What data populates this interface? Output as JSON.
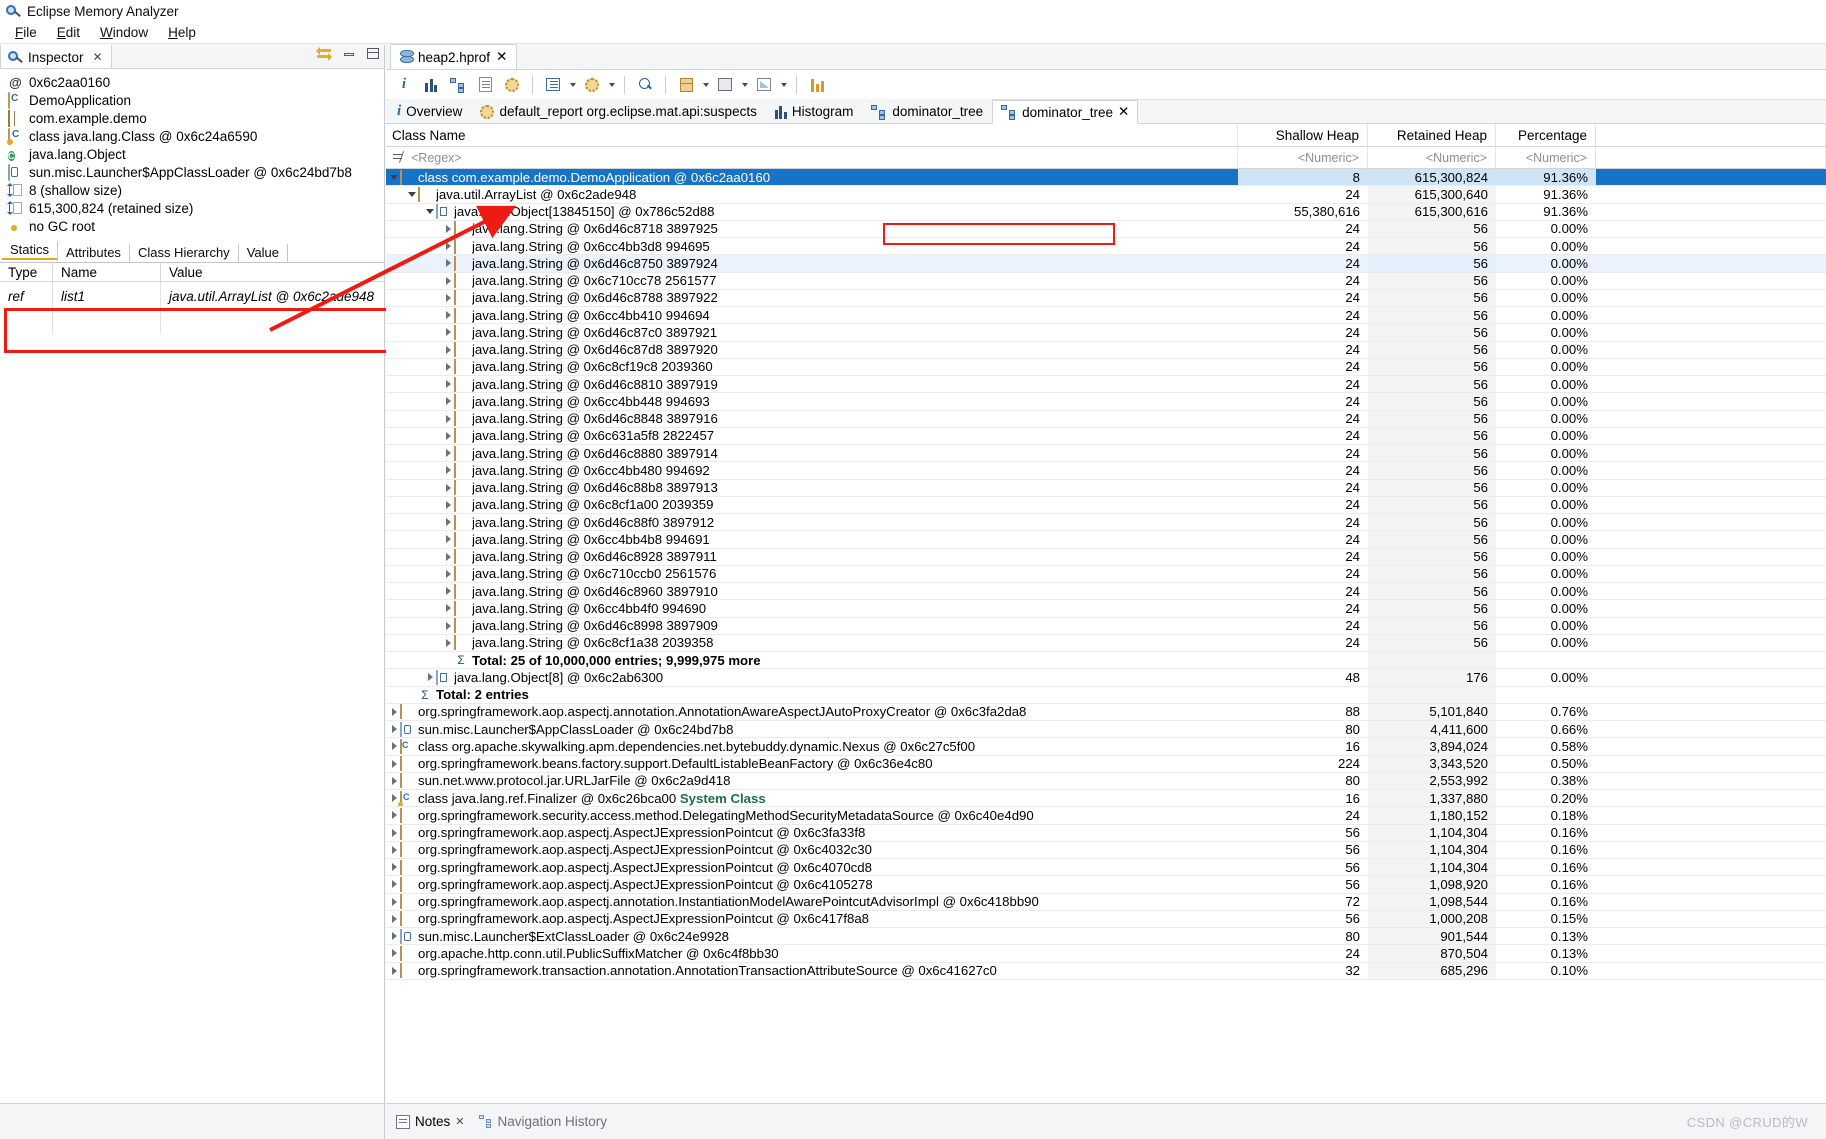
{
  "window": {
    "title": "Eclipse Memory Analyzer",
    "icon": "mat-logo-icon"
  },
  "menu": {
    "items": [
      "File",
      "Edit",
      "Window",
      "Help"
    ]
  },
  "inspector": {
    "tab_label": "Inspector",
    "tab_close": "✕",
    "rows": [
      {
        "icon": "at-icon",
        "text": "0x6c2aa0160"
      },
      {
        "icon": "class-icon",
        "text": "DemoApplication"
      },
      {
        "icon": "package-icon",
        "text": "com.example.demo"
      },
      {
        "icon": "class-object-icon",
        "text": "class java.lang.Class @ 0x6c24a6590"
      },
      {
        "icon": "superclass-icon",
        "text": "java.lang.Object"
      },
      {
        "icon": "classloader-icon",
        "text": "sun.misc.Launcher$AppClassLoader @ 0x6c24bd7b8"
      },
      {
        "icon": "size-icon",
        "text": "8 (shallow size)"
      },
      {
        "icon": "size-icon",
        "text": "615,300,824 (retained size)"
      },
      {
        "icon": "gc-root-icon",
        "text": "no GC root"
      }
    ],
    "subtabs": [
      {
        "label": "Statics",
        "active": true
      },
      {
        "label": "Attributes",
        "active": false
      },
      {
        "label": "Class Hierarchy",
        "active": false
      },
      {
        "label": "Value",
        "active": false
      }
    ],
    "statics_headers": [
      "Type",
      "Name",
      "Value"
    ],
    "statics_rows": [
      {
        "type": "ref",
        "name": "list1",
        "value": "java.util.ArrayList @ 0x6c2ade948"
      }
    ]
  },
  "editor": {
    "tab_label": "heap2.hprof",
    "tab_close": "✕",
    "toolbar_icons": [
      "overview-info-icon",
      "histogram-icon",
      "dominator-tree-icon",
      "report-icon",
      "gear-icon",
      "query-browser-icon",
      "caret-down-icon",
      "oql-icon",
      "caret-down-icon",
      "search-icon",
      "group-icon",
      "caret-down-icon",
      "calculator-icon",
      "caret-down-icon",
      "export-icon",
      "caret-down-icon",
      "compare-icon"
    ],
    "result_tabs": [
      {
        "label": "Overview",
        "icon": "info-icon",
        "active": false
      },
      {
        "label": "default_report org.eclipse.mat.api:suspects",
        "icon": "report-icon",
        "active": false
      },
      {
        "label": "Histogram",
        "icon": "histogram-icon",
        "active": false
      },
      {
        "label": "dominator_tree",
        "icon": "dominator-tree-icon",
        "active": false
      },
      {
        "label": "dominator_tree",
        "icon": "dominator-tree-icon",
        "active": true,
        "close": "✕"
      }
    ]
  },
  "table": {
    "headers": {
      "name": "Class Name",
      "shallow": "Shallow Heap",
      "retained": "Retained Heap",
      "percentage": "Percentage"
    },
    "filters": {
      "name": "<Regex>",
      "shallow": "<Numeric>",
      "retained": "<Numeric>",
      "percentage": "<Numeric>"
    },
    "rows": [
      {
        "indent": 0,
        "arrow": "down",
        "icon": "class-icon",
        "name": "class com.example.demo.DemoApplication @ 0x6c2aa0160",
        "shallow": "8",
        "retained": "615,300,824",
        "pct": "91.36%",
        "state": "selected"
      },
      {
        "indent": 1,
        "arrow": "down",
        "icon": "object-icon",
        "name": "java.util.ArrayList @ 0x6c2ade948",
        "shallow": "24",
        "retained": "615,300,640",
        "pct": "91.36%",
        "state": "normal"
      },
      {
        "indent": 2,
        "arrow": "down",
        "icon": "array-icon",
        "name": "java.lang.Object[13845150] @ 0x786c52d88",
        "shallow": "55,380,616",
        "retained": "615,300,616",
        "pct": "91.36%",
        "state": "normal"
      },
      {
        "indent": 3,
        "arrow": "right",
        "icon": "object-icon",
        "name": "java.lang.String @ 0x6d46c8718  3897925",
        "shallow": "24",
        "retained": "56",
        "pct": "0.00%",
        "state": "normal"
      },
      {
        "indent": 3,
        "arrow": "right",
        "icon": "object-icon",
        "name": "java.lang.String @ 0x6cc4bb3d8  994695",
        "shallow": "24",
        "retained": "56",
        "pct": "0.00%",
        "state": "normal"
      },
      {
        "indent": 3,
        "arrow": "right",
        "icon": "object-icon",
        "name": "java.lang.String @ 0x6d46c8750  3897924",
        "shallow": "24",
        "retained": "56",
        "pct": "0.00%",
        "state": "alt"
      },
      {
        "indent": 3,
        "arrow": "right",
        "icon": "object-icon",
        "name": "java.lang.String @ 0x6c710cc78  2561577",
        "shallow": "24",
        "retained": "56",
        "pct": "0.00%",
        "state": "normal"
      },
      {
        "indent": 3,
        "arrow": "right",
        "icon": "object-icon",
        "name": "java.lang.String @ 0x6d46c8788  3897922",
        "shallow": "24",
        "retained": "56",
        "pct": "0.00%",
        "state": "normal"
      },
      {
        "indent": 3,
        "arrow": "right",
        "icon": "object-icon",
        "name": "java.lang.String @ 0x6cc4bb410  994694",
        "shallow": "24",
        "retained": "56",
        "pct": "0.00%",
        "state": "normal"
      },
      {
        "indent": 3,
        "arrow": "right",
        "icon": "object-icon",
        "name": "java.lang.String @ 0x6d46c87c0  3897921",
        "shallow": "24",
        "retained": "56",
        "pct": "0.00%",
        "state": "normal"
      },
      {
        "indent": 3,
        "arrow": "right",
        "icon": "object-icon",
        "name": "java.lang.String @ 0x6d46c87d8  3897920",
        "shallow": "24",
        "retained": "56",
        "pct": "0.00%",
        "state": "normal"
      },
      {
        "indent": 3,
        "arrow": "right",
        "icon": "object-icon",
        "name": "java.lang.String @ 0x6c8cf19c8  2039360",
        "shallow": "24",
        "retained": "56",
        "pct": "0.00%",
        "state": "normal"
      },
      {
        "indent": 3,
        "arrow": "right",
        "icon": "object-icon",
        "name": "java.lang.String @ 0x6d46c8810  3897919",
        "shallow": "24",
        "retained": "56",
        "pct": "0.00%",
        "state": "normal"
      },
      {
        "indent": 3,
        "arrow": "right",
        "icon": "object-icon",
        "name": "java.lang.String @ 0x6cc4bb448  994693",
        "shallow": "24",
        "retained": "56",
        "pct": "0.00%",
        "state": "normal"
      },
      {
        "indent": 3,
        "arrow": "right",
        "icon": "object-icon",
        "name": "java.lang.String @ 0x6d46c8848  3897916",
        "shallow": "24",
        "retained": "56",
        "pct": "0.00%",
        "state": "normal"
      },
      {
        "indent": 3,
        "arrow": "right",
        "icon": "object-icon",
        "name": "java.lang.String @ 0x6c631a5f8  2822457",
        "shallow": "24",
        "retained": "56",
        "pct": "0.00%",
        "state": "normal"
      },
      {
        "indent": 3,
        "arrow": "right",
        "icon": "object-icon",
        "name": "java.lang.String @ 0x6d46c8880  3897914",
        "shallow": "24",
        "retained": "56",
        "pct": "0.00%",
        "state": "normal"
      },
      {
        "indent": 3,
        "arrow": "right",
        "icon": "object-icon",
        "name": "java.lang.String @ 0x6cc4bb480  994692",
        "shallow": "24",
        "retained": "56",
        "pct": "0.00%",
        "state": "normal"
      },
      {
        "indent": 3,
        "arrow": "right",
        "icon": "object-icon",
        "name": "java.lang.String @ 0x6d46c88b8  3897913",
        "shallow": "24",
        "retained": "56",
        "pct": "0.00%",
        "state": "normal"
      },
      {
        "indent": 3,
        "arrow": "right",
        "icon": "object-icon",
        "name": "java.lang.String @ 0x6c8cf1a00  2039359",
        "shallow": "24",
        "retained": "56",
        "pct": "0.00%",
        "state": "normal"
      },
      {
        "indent": 3,
        "arrow": "right",
        "icon": "object-icon",
        "name": "java.lang.String @ 0x6d46c88f0  3897912",
        "shallow": "24",
        "retained": "56",
        "pct": "0.00%",
        "state": "normal"
      },
      {
        "indent": 3,
        "arrow": "right",
        "icon": "object-icon",
        "name": "java.lang.String @ 0x6cc4bb4b8  994691",
        "shallow": "24",
        "retained": "56",
        "pct": "0.00%",
        "state": "normal"
      },
      {
        "indent": 3,
        "arrow": "right",
        "icon": "object-icon",
        "name": "java.lang.String @ 0x6d46c8928  3897911",
        "shallow": "24",
        "retained": "56",
        "pct": "0.00%",
        "state": "normal"
      },
      {
        "indent": 3,
        "arrow": "right",
        "icon": "object-icon",
        "name": "java.lang.String @ 0x6c710ccb0  2561576",
        "shallow": "24",
        "retained": "56",
        "pct": "0.00%",
        "state": "normal"
      },
      {
        "indent": 3,
        "arrow": "right",
        "icon": "object-icon",
        "name": "java.lang.String @ 0x6d46c8960  3897910",
        "shallow": "24",
        "retained": "56",
        "pct": "0.00%",
        "state": "normal"
      },
      {
        "indent": 3,
        "arrow": "right",
        "icon": "object-icon",
        "name": "java.lang.String @ 0x6cc4bb4f0  994690",
        "shallow": "24",
        "retained": "56",
        "pct": "0.00%",
        "state": "normal"
      },
      {
        "indent": 3,
        "arrow": "right",
        "icon": "object-icon",
        "name": "java.lang.String @ 0x6d46c8998  3897909",
        "shallow": "24",
        "retained": "56",
        "pct": "0.00%",
        "state": "normal"
      },
      {
        "indent": 3,
        "arrow": "right",
        "icon": "object-icon",
        "name": "java.lang.String @ 0x6c8cf1a38  2039358",
        "shallow": "24",
        "retained": "56",
        "pct": "0.00%",
        "state": "normal"
      },
      {
        "indent": 3,
        "arrow": "none",
        "icon": "sum-more-icon",
        "name": "Total: 25 of 10,000,000 entries; 9,999,975 more",
        "shallow": "",
        "retained": "",
        "pct": "",
        "state": "total"
      },
      {
        "indent": 2,
        "arrow": "right",
        "icon": "array-icon",
        "name": "java.lang.Object[8] @ 0x6c2ab6300",
        "shallow": "48",
        "retained": "176",
        "pct": "0.00%",
        "state": "normal"
      },
      {
        "indent": 1,
        "arrow": "none",
        "icon": "sum-icon",
        "name": "Total: 2 entries",
        "shallow": "",
        "retained": "",
        "pct": "",
        "state": "total"
      },
      {
        "indent": 0,
        "arrow": "right",
        "icon": "object-icon",
        "name": "org.springframework.aop.aspectj.annotation.AnnotationAwareAspectJAutoProxyCreator @ 0x6c3fa2da8",
        "shallow": "88",
        "retained": "5,101,840",
        "pct": "0.76%",
        "state": "normal"
      },
      {
        "indent": 0,
        "arrow": "right",
        "icon": "classloader-icon",
        "name": "sun.misc.Launcher$AppClassLoader @ 0x6c24bd7b8",
        "shallow": "80",
        "retained": "4,411,600",
        "pct": "0.66%",
        "state": "normal"
      },
      {
        "indent": 0,
        "arrow": "right",
        "icon": "class-icon",
        "name": "class org.apache.skywalking.apm.dependencies.net.bytebuddy.dynamic.Nexus @ 0x6c27c5f00",
        "shallow": "16",
        "retained": "3,894,024",
        "pct": "0.58%",
        "state": "normal"
      },
      {
        "indent": 0,
        "arrow": "right",
        "icon": "object-icon",
        "name": "org.springframework.beans.factory.support.DefaultListableBeanFactory @ 0x6c36e4c80",
        "shallow": "224",
        "retained": "3,343,520",
        "pct": "0.50%",
        "state": "normal"
      },
      {
        "indent": 0,
        "arrow": "right",
        "icon": "object-icon",
        "name": "sun.net.www.protocol.jar.URLJarFile @ 0x6c2a9d418",
        "shallow": "80",
        "retained": "2,553,992",
        "pct": "0.38%",
        "state": "normal"
      },
      {
        "indent": 0,
        "arrow": "right",
        "icon": "class-object-icon",
        "name": "class java.lang.ref.Finalizer @ 0x6c26bca00",
        "suffix": "System Class",
        "shallow": "16",
        "retained": "1,337,880",
        "pct": "0.20%",
        "state": "normal"
      },
      {
        "indent": 0,
        "arrow": "right",
        "icon": "object-icon",
        "name": "org.springframework.security.access.method.DelegatingMethodSecurityMetadataSource @ 0x6c40e4d90",
        "shallow": "24",
        "retained": "1,180,152",
        "pct": "0.18%",
        "state": "normal"
      },
      {
        "indent": 0,
        "arrow": "right",
        "icon": "object-icon",
        "name": "org.springframework.aop.aspectj.AspectJExpressionPointcut @ 0x6c3fa33f8",
        "shallow": "56",
        "retained": "1,104,304",
        "pct": "0.16%",
        "state": "normal"
      },
      {
        "indent": 0,
        "arrow": "right",
        "icon": "object-icon",
        "name": "org.springframework.aop.aspectj.AspectJExpressionPointcut @ 0x6c4032c30",
        "shallow": "56",
        "retained": "1,104,304",
        "pct": "0.16%",
        "state": "normal"
      },
      {
        "indent": 0,
        "arrow": "right",
        "icon": "object-icon",
        "name": "org.springframework.aop.aspectj.AspectJExpressionPointcut @ 0x6c4070cd8",
        "shallow": "56",
        "retained": "1,104,304",
        "pct": "0.16%",
        "state": "normal"
      },
      {
        "indent": 0,
        "arrow": "right",
        "icon": "object-icon",
        "name": "org.springframework.aop.aspectj.AspectJExpressionPointcut @ 0x6c4105278",
        "shallow": "56",
        "retained": "1,098,920",
        "pct": "0.16%",
        "state": "normal"
      },
      {
        "indent": 0,
        "arrow": "right",
        "icon": "object-icon",
        "name": "org.springframework.aop.aspectj.annotation.InstantiationModelAwarePointcutAdvisorImpl @ 0x6c418bb90",
        "shallow": "72",
        "retained": "1,098,544",
        "pct": "0.16%",
        "state": "normal"
      },
      {
        "indent": 0,
        "arrow": "right",
        "icon": "object-icon",
        "name": "org.springframework.aop.aspectj.AspectJExpressionPointcut @ 0x6c417f8a8",
        "shallow": "56",
        "retained": "1,000,208",
        "pct": "0.15%",
        "state": "normal"
      },
      {
        "indent": 0,
        "arrow": "right",
        "icon": "classloader-icon",
        "name": "sun.misc.Launcher$ExtClassLoader @ 0x6c24e9928",
        "shallow": "80",
        "retained": "901,544",
        "pct": "0.13%",
        "state": "normal"
      },
      {
        "indent": 0,
        "arrow": "right",
        "icon": "object-icon",
        "name": "org.apache.http.conn.util.PublicSuffixMatcher @ 0x6c4f8bb30",
        "shallow": "24",
        "retained": "870,504",
        "pct": "0.13%",
        "state": "normal"
      },
      {
        "indent": 0,
        "arrow": "right",
        "icon": "object-icon",
        "name": "org.springframework.transaction.annotation.AnnotationTransactionAttributeSource @ 0x6c41627c0",
        "shallow": "32",
        "retained": "685,296",
        "pct": "0.10%",
        "state": "normal"
      }
    ]
  },
  "bottom": {
    "notes_tab": "Notes",
    "notes_close": "✕",
    "nav_tab": "Navigation History",
    "watermark": "CSDN @CRUD的W"
  },
  "colors": {
    "selection_blue": "#1673c8",
    "annotation_red": "#ef1b12",
    "alt_row": "#eaf3fc",
    "retained_col": "#f3f4f6"
  }
}
